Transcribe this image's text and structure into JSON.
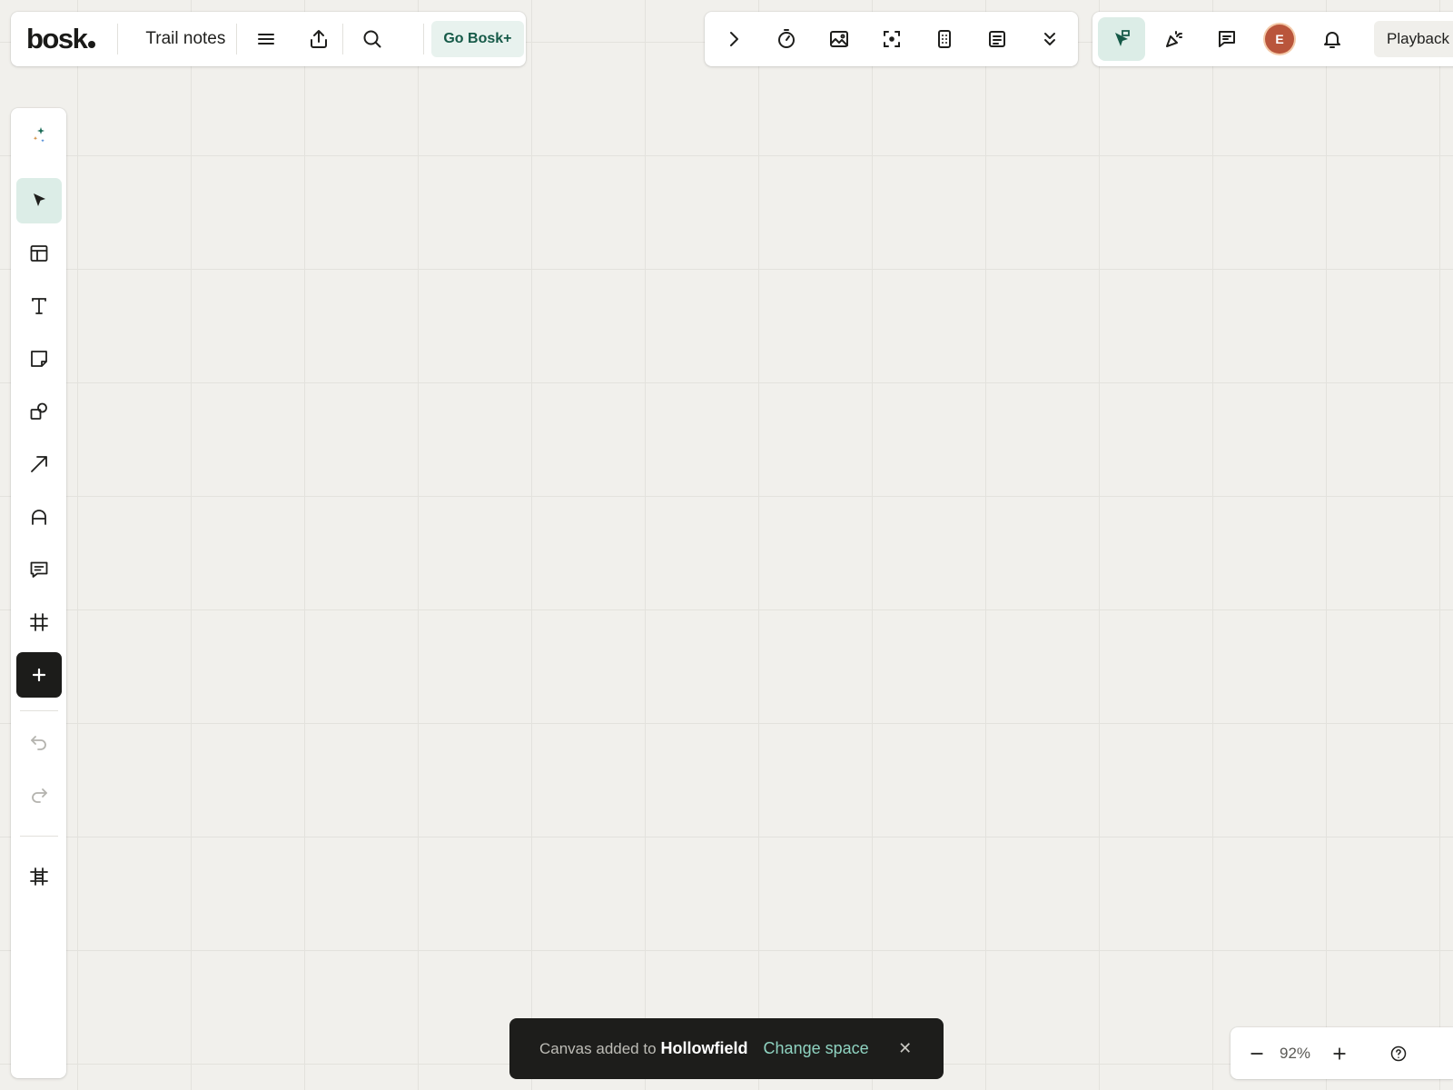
{
  "header": {
    "logo": "bosk",
    "board_title": "Trail notes",
    "upgrade_label": "Go Bosk+",
    "playback_label": "Playback"
  },
  "collaborator": {
    "avatar_initial": "E",
    "avatar_color": "#b9553b"
  },
  "toast": {
    "prefix": "Canvas added to",
    "space_name": "Hollowfield",
    "action_label": "Change space",
    "close_glyph": "✕"
  },
  "zoom": {
    "level": "92%"
  },
  "colors": {
    "accent": "#165a48",
    "accent_bg": "#dcede7",
    "canvas": "#f1f0ec"
  }
}
